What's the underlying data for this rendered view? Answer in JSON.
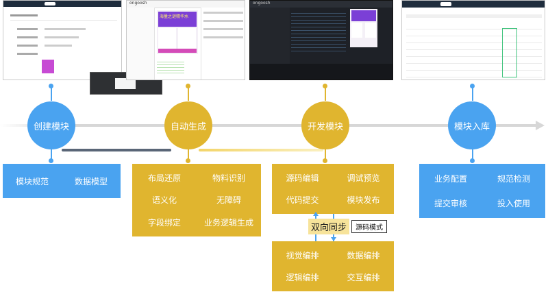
{
  "stages": [
    {
      "label": "创建模块",
      "color": "#4aa3f0"
    },
    {
      "label": "自动生成",
      "color": "#e0b52f"
    },
    {
      "label": "开发模块",
      "color": "#e0b52f"
    },
    {
      "label": "模块入库",
      "color": "#4aa3f0"
    }
  ],
  "create_box": {
    "items": [
      "模块规范",
      "数据模型"
    ]
  },
  "auto_box": {
    "items": [
      "布局还原",
      "物料识别",
      "语义化",
      "无障碍",
      "字段绑定",
      "业务逻辑生成"
    ]
  },
  "dev_box": {
    "items": [
      "源码编辑",
      "调试预览",
      "代码提交",
      "模块发布"
    ]
  },
  "visual_box": {
    "items": [
      "视觉编排",
      "数据编排",
      "逻辑编排",
      "交互编排"
    ]
  },
  "sync": {
    "label": "双向同步",
    "mode_label": "源码模式"
  },
  "library_box": {
    "items": [
      "业务配置",
      "规范检测",
      "提交审核",
      "投入使用"
    ]
  },
  "screenshots": {
    "auto_logo": "ongoosh",
    "auto_banner": "海量之谜精华水",
    "dev_logo": "ongoosh"
  }
}
